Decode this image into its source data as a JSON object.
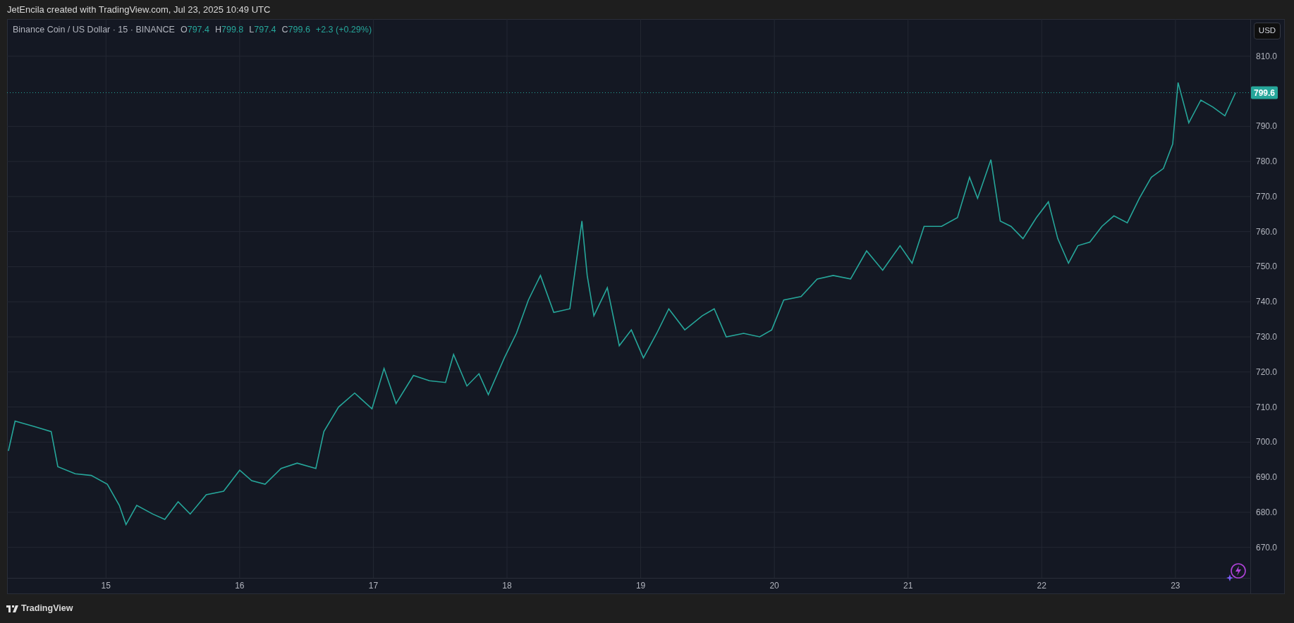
{
  "header": {
    "attribution": "JetEncila created with TradingView.com, Jul 23, 2025 10:49 UTC"
  },
  "legend": {
    "symbol": "Binance Coin / US Dollar · 15 · BINANCE",
    "ohlc": [
      {
        "label": "O",
        "value": "797.4"
      },
      {
        "label": "H",
        "value": "799.8"
      },
      {
        "label": "L",
        "value": "797.4"
      },
      {
        "label": "C",
        "value": "799.6"
      }
    ],
    "change": "+2.3 (+0.29%)"
  },
  "currency_button": "USD",
  "chart": {
    "chart_data": {
      "type": "line",
      "xlim": [
        14.26,
        23.56
      ],
      "ylim": [
        661.3,
        820.6
      ],
      "xticks": [
        15,
        16,
        17,
        18,
        19,
        20,
        21,
        22,
        23
      ],
      "yticks": [
        {
          "value": 670,
          "label": "670.0"
        },
        {
          "value": 680,
          "label": "680.0"
        },
        {
          "value": 690,
          "label": "690.0"
        },
        {
          "value": 700,
          "label": "700.0"
        },
        {
          "value": 710,
          "label": "710.0"
        },
        {
          "value": 720,
          "label": "720.0"
        },
        {
          "value": 730,
          "label": "730.0"
        },
        {
          "value": 740,
          "label": "740.0"
        },
        {
          "value": 750,
          "label": "750.0"
        },
        {
          "value": 760,
          "label": "760.0"
        },
        {
          "value": 770,
          "label": "770.0"
        },
        {
          "value": 780,
          "label": "780.0"
        },
        {
          "value": 790,
          "label": "790.0"
        },
        {
          "value": 810,
          "label": "810.0"
        }
      ],
      "grid": true,
      "ref_lines": [
        {
          "axis": "y",
          "value": 799.6,
          "label": "799.6",
          "color": "#26a69a"
        }
      ],
      "x": [
        14.27,
        14.32,
        14.46,
        14.59,
        14.64,
        14.77,
        14.89,
        15.01,
        15.1,
        15.15,
        15.23,
        15.35,
        15.44,
        15.54,
        15.63,
        15.75,
        15.88,
        16.0,
        16.09,
        16.19,
        16.31,
        16.43,
        16.57,
        16.63,
        16.74,
        16.86,
        16.99,
        17.08,
        17.17,
        17.3,
        17.42,
        17.54,
        17.6,
        17.7,
        17.79,
        17.86,
        17.98,
        18.07,
        18.16,
        18.25,
        18.35,
        18.47,
        18.56,
        18.6,
        18.65,
        18.75,
        18.84,
        18.93,
        19.02,
        19.12,
        19.21,
        19.33,
        19.46,
        19.55,
        19.64,
        19.77,
        19.89,
        19.98,
        20.07,
        20.2,
        20.32,
        20.44,
        20.57,
        20.69,
        20.81,
        20.94,
        21.03,
        21.12,
        21.25,
        21.37,
        21.46,
        21.52,
        21.62,
        21.69,
        21.77,
        21.86,
        21.96,
        22.05,
        22.12,
        22.2,
        22.27,
        22.36,
        22.45,
        22.54,
        22.64,
        22.73,
        22.82,
        22.91,
        22.98,
        23.02,
        23.1,
        23.19,
        23.28,
        23.37,
        23.45
      ],
      "series": [
        {
          "color": "#26a69a",
          "values": [
            697.5,
            706,
            704.5,
            703,
            693,
            691,
            690.5,
            688,
            682,
            676.5,
            682,
            679.5,
            678,
            683,
            679.5,
            685,
            686,
            692,
            689,
            688,
            692.5,
            694,
            692.5,
            703,
            710,
            714,
            709.5,
            721,
            711,
            719,
            717.5,
            717,
            725,
            716,
            719.5,
            713.5,
            724,
            731,
            740.5,
            747.5,
            737,
            738,
            763,
            747.5,
            736,
            744,
            727.5,
            732,
            724,
            731,
            738,
            732,
            736,
            738,
            730,
            731,
            730,
            732,
            740.5,
            741.5,
            746.5,
            747.5,
            746.5,
            754.5,
            749,
            756,
            751,
            761.5,
            761.5,
            764,
            775.5,
            769.5,
            780.5,
            763,
            761.5,
            758,
            764,
            768.5,
            758,
            751,
            756,
            757,
            761.5,
            764.5,
            762.5,
            769.5,
            775.5,
            778,
            785,
            802.5,
            791,
            797.5,
            795.5,
            793,
            799.6
          ]
        }
      ]
    }
  },
  "footer": {
    "brand": "TradingView"
  }
}
